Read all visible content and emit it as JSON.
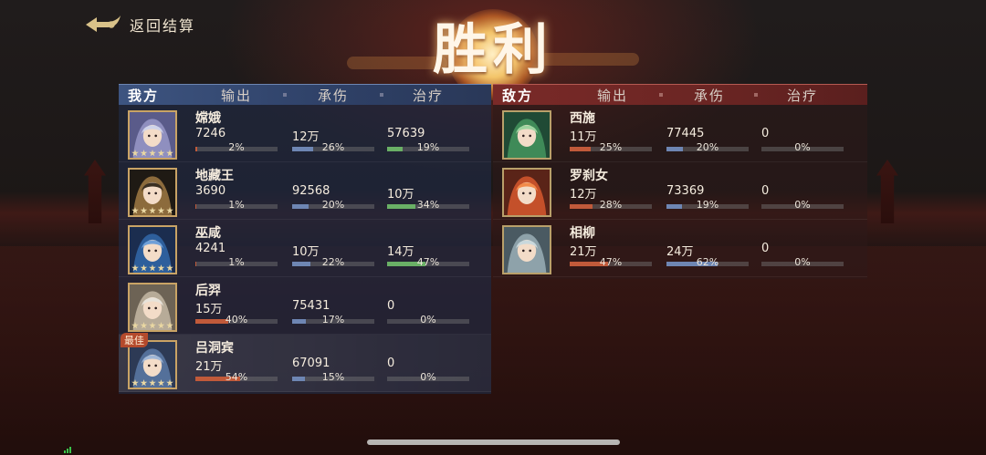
{
  "back_button": {
    "label": "返回结算",
    "icon": "cloud-arrow-icon"
  },
  "title": "胜利",
  "ally_panel": {
    "team_label": "我方",
    "columns": [
      "输出",
      "承伤",
      "治疗"
    ],
    "best_badge": "最佳",
    "rows": [
      {
        "name": "嫦娥",
        "avatar": "avatar-change-icon",
        "stars": 5,
        "output": "7246",
        "output_pct": "2%",
        "damage_taken": "12万",
        "damage_taken_pct": "26%",
        "healing": "57639",
        "healing_pct": "19%"
      },
      {
        "name": "地藏王",
        "avatar": "avatar-dizangwang-icon",
        "stars": 5,
        "output": "3690",
        "output_pct": "1%",
        "damage_taken": "92568",
        "damage_taken_pct": "20%",
        "healing": "10万",
        "healing_pct": "34%"
      },
      {
        "name": "巫咸",
        "avatar": "avatar-wuxian-icon",
        "stars": 5,
        "output": "4241",
        "output_pct": "1%",
        "damage_taken": "10万",
        "damage_taken_pct": "22%",
        "healing": "14万",
        "healing_pct": "47%"
      },
      {
        "name": "后羿",
        "avatar": "avatar-houyi-icon",
        "stars": 5,
        "output": "15万",
        "output_pct": "40%",
        "damage_taken": "75431",
        "damage_taken_pct": "17%",
        "healing": "0",
        "healing_pct": "0%"
      },
      {
        "name": "吕洞宾",
        "avatar": "avatar-lvdongbin-icon",
        "stars": 5,
        "best": true,
        "output": "21万",
        "output_pct": "54%",
        "damage_taken": "67091",
        "damage_taken_pct": "15%",
        "healing": "0",
        "healing_pct": "0%"
      }
    ]
  },
  "enemy_panel": {
    "team_label": "敌方",
    "columns": [
      "输出",
      "承伤",
      "治疗"
    ],
    "rows": [
      {
        "name": "西施",
        "avatar": "avatar-xishi-icon",
        "output": "11万",
        "output_pct": "25%",
        "damage_taken": "77445",
        "damage_taken_pct": "20%",
        "healing": "0",
        "healing_pct": "0%"
      },
      {
        "name": "罗刹女",
        "avatar": "avatar-luoshanv-icon",
        "output": "12万",
        "output_pct": "28%",
        "damage_taken": "73369",
        "damage_taken_pct": "19%",
        "healing": "0",
        "healing_pct": "0%"
      },
      {
        "name": "相柳",
        "avatar": "avatar-xiangliu-icon",
        "output": "21万",
        "output_pct": "47%",
        "damage_taken": "24万",
        "damage_taken_pct": "62%",
        "healing": "0",
        "healing_pct": "0%"
      }
    ]
  },
  "colors": {
    "output_bar": "#c15a3a",
    "damage_taken_bar": "#6e86b3",
    "healing_bar": "#6ab066",
    "ally_header": "#3d5480",
    "enemy_header": "#7a2a28"
  }
}
